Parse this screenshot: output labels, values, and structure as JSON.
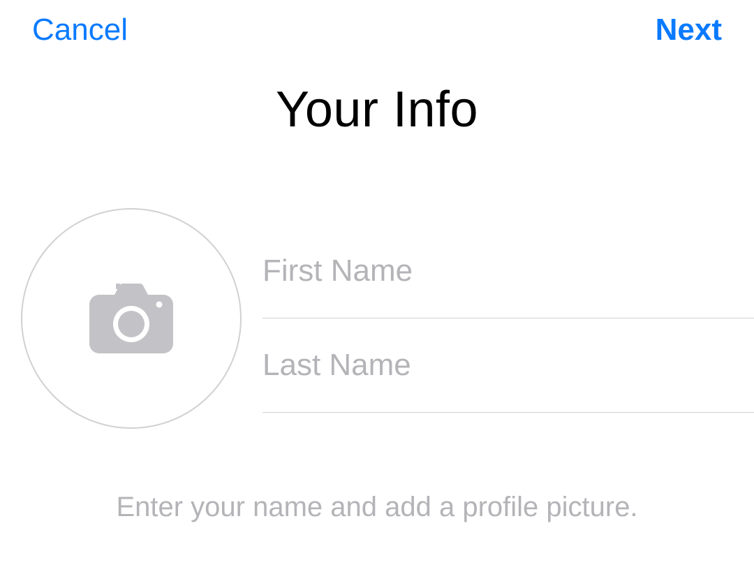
{
  "nav": {
    "cancel_label": "Cancel",
    "next_label": "Next"
  },
  "title": "Your Info",
  "form": {
    "first_name_placeholder": "First Name",
    "first_name_value": "",
    "last_name_placeholder": "Last Name",
    "last_name_value": ""
  },
  "hint": "Enter your name and add a profile picture."
}
